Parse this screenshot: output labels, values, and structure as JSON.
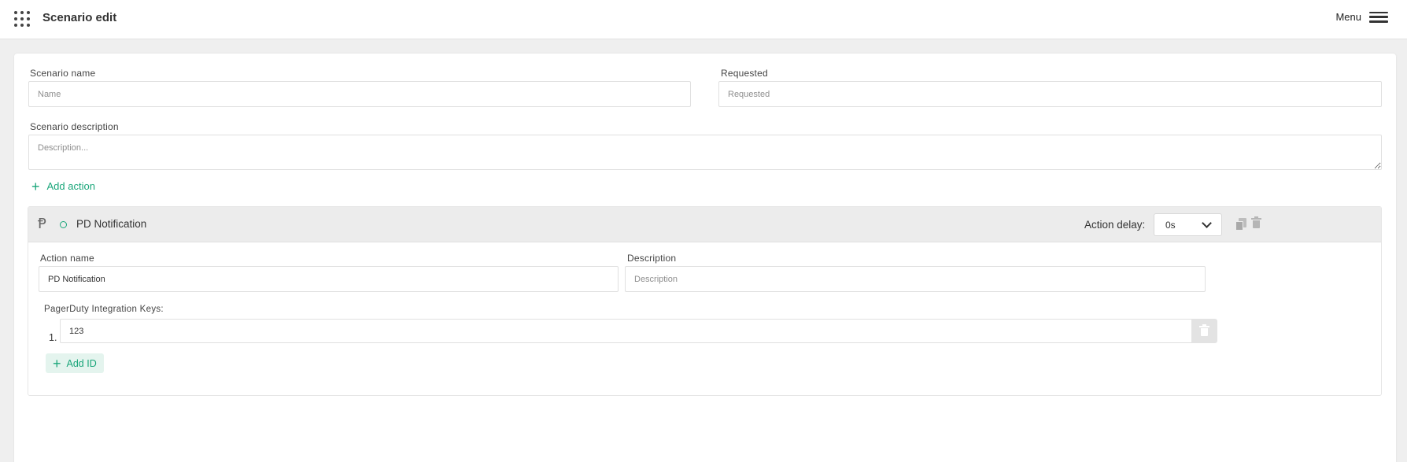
{
  "header": {
    "title": "Scenario edit",
    "menu_label": "Menu"
  },
  "form": {
    "scenario_name": {
      "label": "Scenario name",
      "value": "",
      "placeholder": "Name"
    },
    "requested": {
      "label": "Requested",
      "value": "",
      "placeholder": "Requested"
    },
    "scenario_description": {
      "label": "Scenario description",
      "value": "",
      "placeholder": "Description..."
    },
    "add_action_label": "Add action"
  },
  "action": {
    "title": "PD Notification",
    "delay_label": "Action delay:",
    "delay_value": "0s",
    "action_name": {
      "label": "Action name",
      "value": "PD Notification",
      "placeholder": ""
    },
    "description": {
      "label": "Description",
      "value": "",
      "placeholder": "Description"
    },
    "integration_keys": {
      "label": "PagerDuty Integration Keys:",
      "items": [
        {
          "index": "1.",
          "value": "123"
        }
      ],
      "add_label": "Add ID"
    }
  },
  "colors": {
    "accent": "#1aa67a",
    "page_background": "#efefef",
    "header_background": "#ffffff",
    "action_header_background": "#ececec"
  },
  "icons": {
    "apps": "apps-grid-icon",
    "menu": "hamburger-icon",
    "add": "plus-icon",
    "action_type": "pagerduty-p-icon",
    "status": "status-circle-icon",
    "select": "chevron-down-icon",
    "duplicate": "copy-icon",
    "delete": "trash-icon"
  }
}
